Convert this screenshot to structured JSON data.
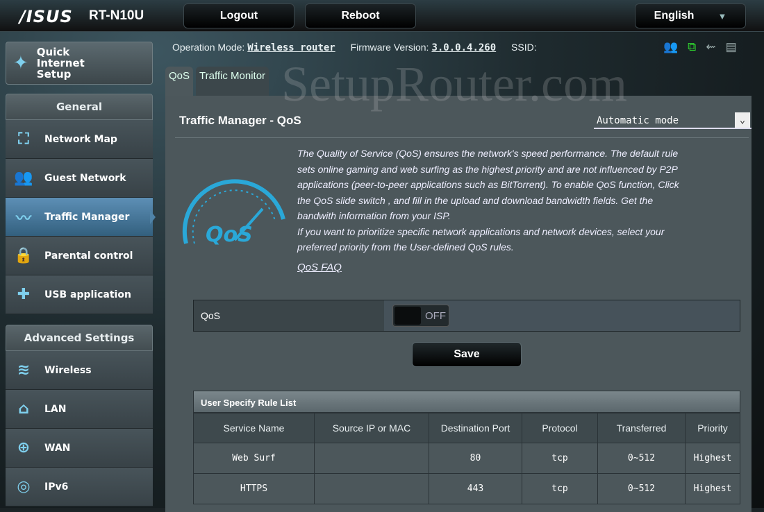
{
  "header": {
    "brand": "/ISUS",
    "model": "RT-N10U",
    "logout": "Logout",
    "reboot": "Reboot",
    "language": "English"
  },
  "status": {
    "op_mode_label": "Operation Mode:",
    "op_mode": "Wireless router",
    "fw_label": "Firmware Version:",
    "fw": "3.0.0.4.260",
    "ssid_label": "SSID:"
  },
  "watermark": "SetupRouter.com",
  "sidebar": {
    "quick_setup": "Quick Internet Setup",
    "general": "General",
    "general_items": [
      {
        "label": "Network Map",
        "icon": "⛶"
      },
      {
        "label": "Guest Network",
        "icon": "👥"
      },
      {
        "label": "Traffic Manager",
        "icon": "〰"
      },
      {
        "label": "Parental control",
        "icon": "🔒"
      },
      {
        "label": "USB application",
        "icon": "✚"
      }
    ],
    "advanced": "Advanced Settings",
    "advanced_items": [
      {
        "label": "Wireless",
        "icon": "≋"
      },
      {
        "label": "LAN",
        "icon": "⌂"
      },
      {
        "label": "WAN",
        "icon": "⊕"
      },
      {
        "label": "IPv6",
        "icon": "◎"
      }
    ]
  },
  "tabs": [
    "QoS",
    "Traffic Monitor"
  ],
  "main": {
    "title": "Traffic Manager - QoS",
    "mode": "Automatic mode",
    "description": "The Quality of Service (QoS) ensures the network's speed performance. The default rule sets online gaming and web surfing as the highest priority and are not influenced by P2P applications (peer-to-peer applications such as BitTorrent). To enable QoS function, Click the QoS slide switch , and fill in the upload and download bandwidth fields. Get the bandwith information from your ISP.",
    "description2": "If you want to prioritize specific network applications and network devices, select your preferred priority from the User-defined QoS rules.",
    "faq": "QoS FAQ",
    "gauge_label": "QoS",
    "qos_label": "QoS",
    "qos_state": "OFF",
    "save": "Save"
  },
  "rules": {
    "title": "User Specify Rule List",
    "columns": [
      "Service Name",
      "Source IP or MAC",
      "Destination Port",
      "Protocol",
      "Transferred",
      "Priority"
    ],
    "rows": [
      [
        "Web Surf",
        "",
        "80",
        "tcp",
        "0~512",
        "Highest"
      ],
      [
        "HTTPS",
        "",
        "443",
        "tcp",
        "0~512",
        "Highest"
      ]
    ]
  }
}
